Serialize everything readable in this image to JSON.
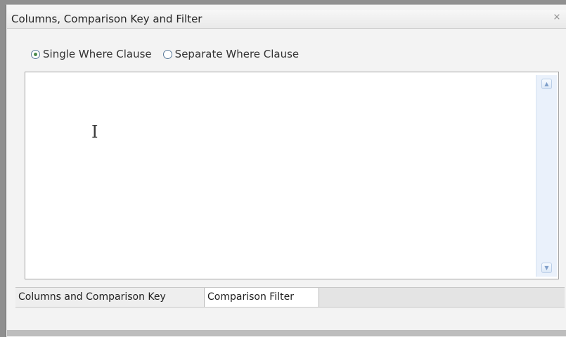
{
  "panel": {
    "title": "Columns, Comparison Key and Filter",
    "close_icon": "close-icon",
    "radio_options": [
      {
        "label": "Single Where Clause",
        "checked": true
      },
      {
        "label": "Separate Where Clause",
        "checked": false
      }
    ],
    "editor_text": "",
    "tabs": [
      {
        "label": "Columns and Comparison Key",
        "active": false
      },
      {
        "label": "Comparison Filter",
        "active": true
      }
    ]
  },
  "colors": {
    "accent": "#4b8a4b",
    "scrollbar": "#eaf1fb"
  }
}
